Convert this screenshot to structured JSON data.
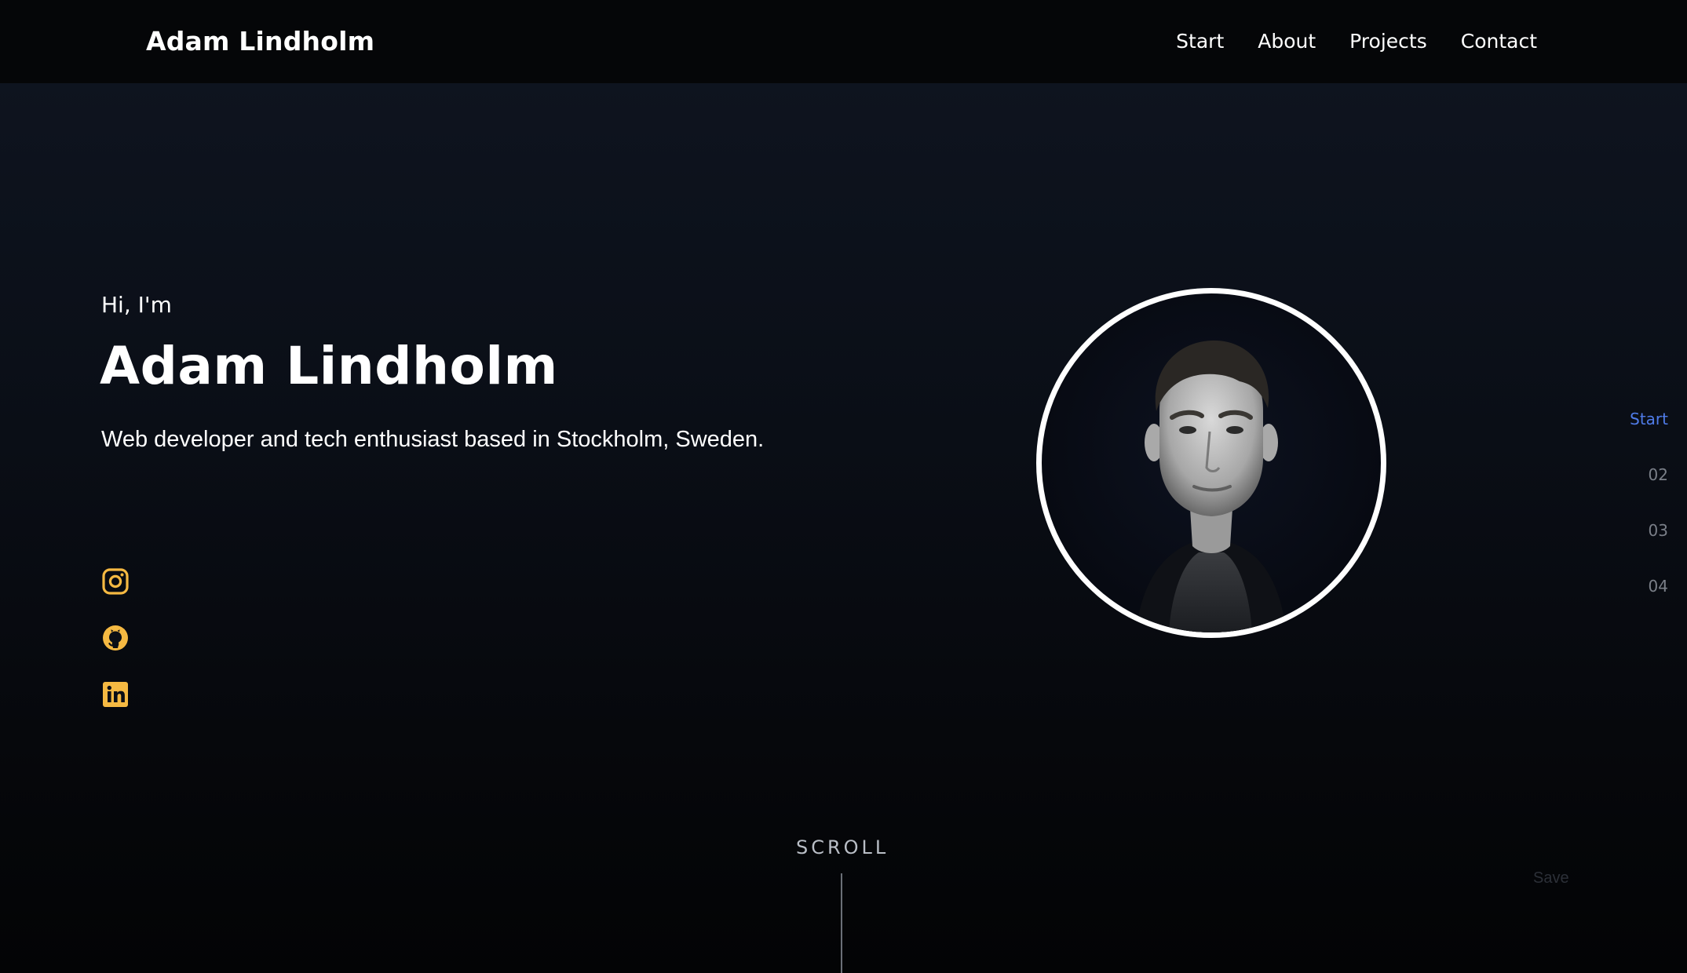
{
  "header": {
    "brand": "Adam Lindholm",
    "nav": [
      "Start",
      "About",
      "Projects",
      "Contact"
    ]
  },
  "hero": {
    "greeting": "Hi, I'm",
    "name": "Adam Lindholm",
    "tagline": "Web developer and tech enthusiast based in Stockholm, Sweden."
  },
  "social": [
    {
      "icon": "instagram-icon"
    },
    {
      "icon": "github-icon"
    },
    {
      "icon": "linkedin-icon"
    }
  ],
  "section_nav": {
    "items": [
      "Start",
      "02",
      "03",
      "04"
    ],
    "active": "Start"
  },
  "scroll": {
    "label": "SCROLL"
  },
  "footer_hint": {
    "save": "Save"
  },
  "colors": {
    "accent_icon": "#f5b942",
    "active_section": "#4f7be8",
    "background": "#0a0e16"
  }
}
